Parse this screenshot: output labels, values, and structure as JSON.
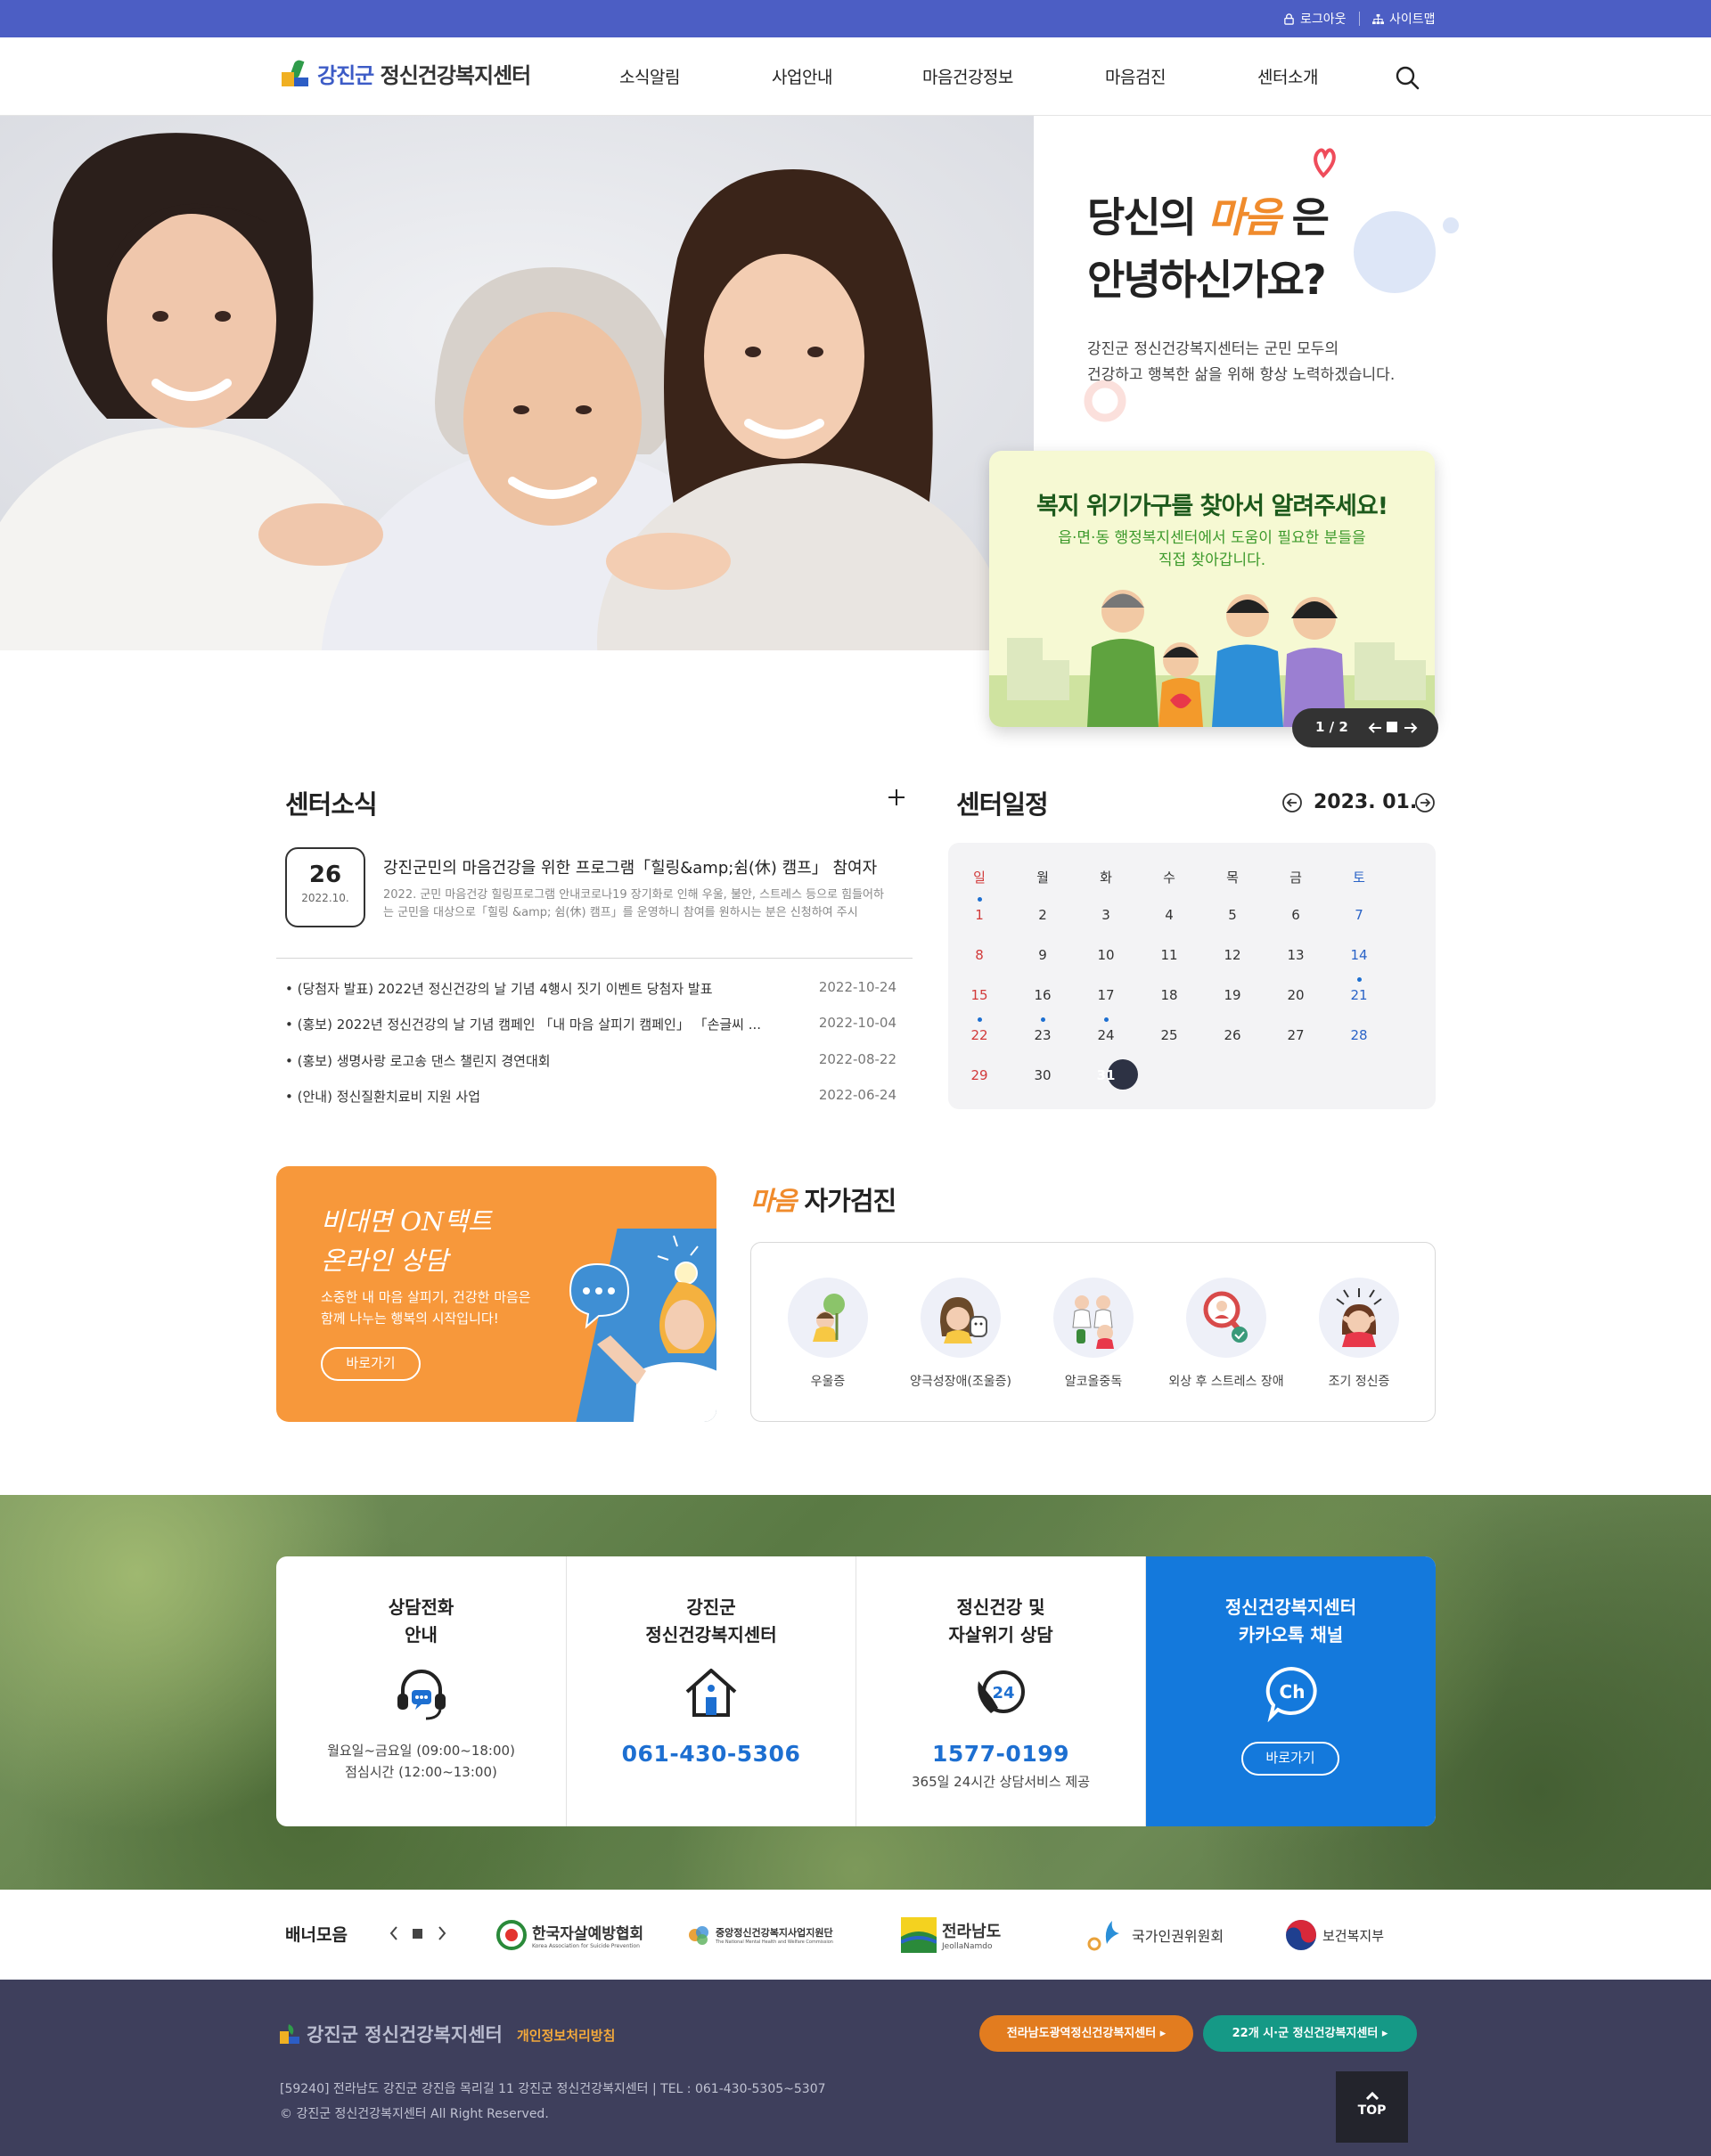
{
  "topbar": {
    "login": "로그아웃",
    "sitemap": "사이트맵"
  },
  "header": {
    "logo_region": "강진군",
    "logo_name": "정신건강복지센터",
    "nav": [
      "소식알림",
      "사업안내",
      "마음건강정보",
      "마음검진",
      "센터소개"
    ]
  },
  "hero": {
    "title_a": "당신의",
    "title_maeum": "마음",
    "title_b": "은",
    "title_line2": "안녕하신가요?",
    "desc_line1": "강진군 정신건강복지센터는 군민 모두의",
    "desc_line2": "건강하고 행복한 삶을 위해 항상 노력하겠습니다."
  },
  "popup": {
    "title": "복지 위기가구를 찾아서 알려주세요!",
    "sub_line1": "읍·면·동 행정복지센터에서 도움이 필요한 분들을",
    "sub_line2": "직접 찾아갑니다.",
    "counter": "1 / 2"
  },
  "news": {
    "title": "센터소식",
    "featured": {
      "day": "26",
      "ym": "2022.10.",
      "title": "강진군민의 마음건강을 위한 프로그램「힐링&amp;쉼(休) 캠프」 참여자 ...",
      "summary": "2022. 군민 마음건강 힐링프로그램 안내코로나19 장기화로 인해 우울, 불안, 스트레스 등으로 힘들어하는 군민을 대상으로「힐링 &amp; 쉼(休) 캠프」를 운영하니 참여를 원하시는 분은 신청하여 주시"
    },
    "items": [
      {
        "title": "(당첨자 발표) 2022년 정신건강의 날 기념 4행시 짓기 이벤트 당첨자 발표",
        "date": "2022-10-24"
      },
      {
        "title": "(홍보) 2022년 정신건강의 날 기념 캠페인 「내 마음 살피기 캠페인」 「손글씨 ...",
        "date": "2022-10-04"
      },
      {
        "title": "(홍보) 생명사랑 로고송 댄스 챌린지 경연대회",
        "date": "2022-08-22"
      },
      {
        "title": "(안내) 정신질환치료비 지원 사업",
        "date": "2022-06-24"
      }
    ]
  },
  "calendar": {
    "title": "센터일정",
    "month": "2023. 01.",
    "weekdays": [
      "일",
      "월",
      "화",
      "수",
      "목",
      "금",
      "토"
    ],
    "weeks": [
      [
        "1",
        "2",
        "3",
        "4",
        "5",
        "6",
        "7"
      ],
      [
        "8",
        "9",
        "10",
        "11",
        "12",
        "13",
        "14"
      ],
      [
        "15",
        "16",
        "17",
        "18",
        "19",
        "20",
        "21"
      ],
      [
        "22",
        "23",
        "24",
        "25",
        "26",
        "27",
        "28"
      ],
      [
        "29",
        "30",
        "31",
        "",
        "",
        "",
        ""
      ]
    ],
    "event_days": [
      "1",
      "21",
      "22",
      "23",
      "24"
    ],
    "today": "31"
  },
  "ontact": {
    "title_line1": "비대면 ON택트",
    "title_line2": "온라인 상담",
    "desc_line1": "소중한 내 마음 살피기, 건강한 마음은",
    "desc_line2": "함께 나누는 행복의 시작입니다!",
    "button": "바로가기"
  },
  "selfcheck": {
    "title_o": "마음",
    "title": "자가검진",
    "items": [
      {
        "label": "우울증",
        "icon": "depression-icon"
      },
      {
        "label": "양극성장애(조울증)",
        "icon": "bipolar-icon"
      },
      {
        "label": "알코올중독",
        "icon": "alcohol-icon"
      },
      {
        "label": "외상 후 스트레스 장애",
        "icon": "ptsd-icon"
      },
      {
        "label": "조기 정신증",
        "icon": "psychosis-icon"
      }
    ]
  },
  "contact": {
    "c1": {
      "title1": "상담전화",
      "title2": "안내",
      "note1": "월요일~금요일 (09:00~18:00)",
      "note2": "점심시간 (12:00~13:00)"
    },
    "c2": {
      "title1": "강진군",
      "title2": "정신건강복지센터",
      "phone": "061-430-5306"
    },
    "c3": {
      "title1": "정신건강 및",
      "title2": "자살위기 상담",
      "phone": "1577-0199",
      "note": "365일 24시간 상담서비스 제공",
      "icon_text": "24"
    },
    "c4": {
      "title1": "정신건강복지센터",
      "title2": "카카오톡 채널",
      "icon_text": "Ch",
      "button": "바로가기"
    }
  },
  "banners": {
    "label": "배너모음",
    "items": [
      {
        "name": "한국자살예방협회",
        "sub": "Korea Association for Suicide Prevention"
      },
      {
        "name": "중앙정신건강복지사업지원단",
        "sub": "The National Mental Health and Welfare Commission"
      },
      {
        "name": "전라남도",
        "sub": "JeollaNamdo"
      },
      {
        "name": "국가인권위원회"
      },
      {
        "name": "보건복지부"
      }
    ]
  },
  "footer": {
    "logo": "강진군 정신건강복지센터",
    "privacy": "개인정보처리방침",
    "btn1": "전라남도광역정신건강복지센터",
    "btn2": "22개 시·군 정신건강복지센터",
    "address": "[59240] 전라남도 강진군 강진읍 목리길 11 강진군 정신건강복지센터 | TEL : 061-430-5305~5307",
    "copy": "© 강진군 정신건강복지센터 All Right Reserved.",
    "top": "TOP"
  },
  "colors": {
    "topbar": "#4c5ec4",
    "accent_orange": "#f08b2c",
    "blue": "#1d6fd1",
    "footer": "#3e3f5c"
  }
}
